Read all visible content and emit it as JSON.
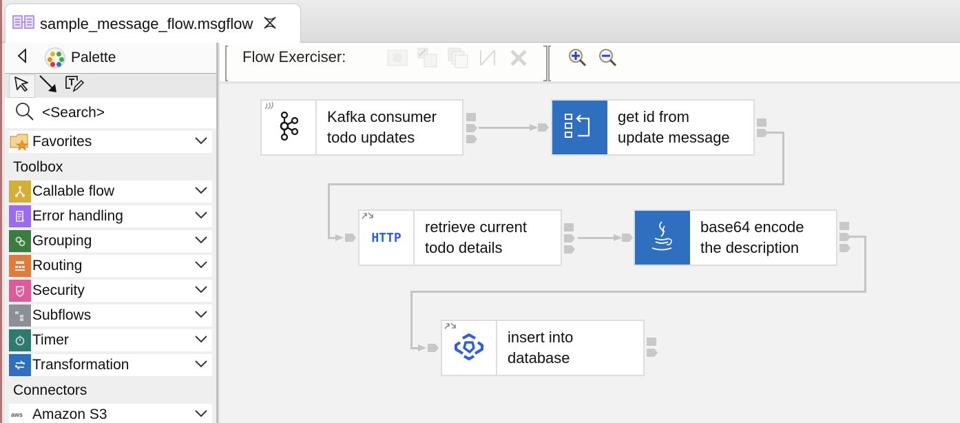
{
  "editor_tab": {
    "title": "sample_message_flow.msgflow",
    "icon": "msgflow-file-icon",
    "close_icon": "close-icon"
  },
  "palette": {
    "title": "Palette",
    "collapse_icon": "triangle-left-icon",
    "tools": [
      {
        "name": "select-tool",
        "icon": "pointer-arrow-icon",
        "selected": true
      },
      {
        "name": "connection-tool",
        "icon": "connection-arrow-icon",
        "selected": false
      },
      {
        "name": "note-tool",
        "icon": "text-pencil-icon",
        "selected": false
      }
    ],
    "search_placeholder": "<Search>",
    "favorites_label": "Favorites",
    "toolbox_label": "Toolbox",
    "toolbox_items": [
      {
        "label": "Callable flow",
        "color": "#d4af37"
      },
      {
        "label": "Error handling",
        "color": "#9b6bf2"
      },
      {
        "label": "Grouping",
        "color": "#3b7d3f"
      },
      {
        "label": "Routing",
        "color": "#e07b39"
      },
      {
        "label": "Security",
        "color": "#e05a9a"
      },
      {
        "label": "Subflows",
        "color": "#8c8f96"
      },
      {
        "label": "Timer",
        "color": "#2f7a6f"
      },
      {
        "label": "Transformation",
        "color": "#2f6fc0"
      }
    ],
    "connectors_label": "Connectors",
    "connector_items": [
      {
        "label": "Amazon S3",
        "icon": "aws-icon"
      }
    ]
  },
  "toolbar": {
    "flow_exerciser_label": "Flow Exerciser:",
    "buttons": [
      {
        "name": "start-recording-button",
        "icon": "record-icon",
        "enabled": false
      },
      {
        "name": "send-message-button",
        "icon": "send-message-icon",
        "enabled": false
      },
      {
        "name": "view-recorded-button",
        "icon": "recorded-messages-icon",
        "enabled": false
      },
      {
        "name": "view-path-button",
        "icon": "path-icon",
        "enabled": false
      },
      {
        "name": "stop-button",
        "icon": "stop-x-icon",
        "enabled": false
      },
      {
        "name": "zoom-in-button",
        "icon": "zoom-in-icon",
        "enabled": true
      },
      {
        "name": "zoom-out-button",
        "icon": "zoom-out-icon",
        "enabled": true
      }
    ]
  },
  "flow": {
    "nodes": [
      {
        "id": "kafka",
        "line1": "Kafka consumer",
        "line2": "todo updates",
        "type": "KafkaConsumer",
        "icon": "kafka-icon"
      },
      {
        "id": "getid",
        "line1": "get id from",
        "line2": "update message",
        "type": "Mapping",
        "icon": "mapping-icon"
      },
      {
        "id": "http",
        "line1": "retrieve current",
        "line2": "todo details",
        "type": "HTTPRequest",
        "icon": "http-icon",
        "icon_text": "HTTP"
      },
      {
        "id": "java",
        "line1": "base64 encode",
        "line2": "the description",
        "type": "JavaCompute",
        "icon": "java-icon"
      },
      {
        "id": "db",
        "line1": "insert into",
        "line2": "database",
        "type": "DatabaseConnector",
        "icon": "database-connector-icon"
      }
    ],
    "connections": [
      {
        "from": "kafka",
        "to": "getid"
      },
      {
        "from": "getid",
        "to": "http"
      },
      {
        "from": "http",
        "to": "java"
      },
      {
        "from": "java",
        "to": "db"
      }
    ]
  }
}
